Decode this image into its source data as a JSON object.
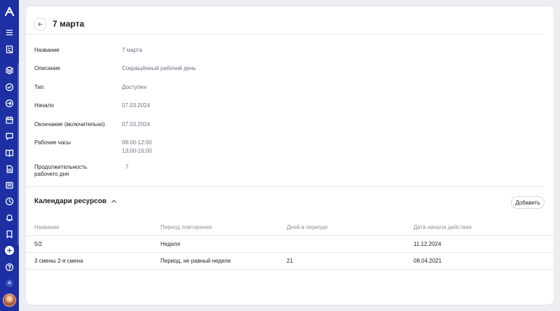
{
  "rail": {
    "items": [
      {
        "icon": "logo-icon"
      },
      {
        "icon": "menu-icon"
      },
      {
        "icon": "report-icon"
      },
      {
        "icon": "layers-icon"
      },
      {
        "icon": "check-circle-icon"
      },
      {
        "icon": "arrow-circle-icon"
      },
      {
        "icon": "calendar-icon"
      },
      {
        "icon": "chat-icon"
      },
      {
        "icon": "book-icon"
      },
      {
        "icon": "document-icon"
      },
      {
        "icon": "news-icon"
      },
      {
        "icon": "clock-icon"
      },
      {
        "icon": "bell-icon"
      },
      {
        "icon": "bookmark-icon"
      },
      {
        "icon": "plus-icon"
      },
      {
        "icon": "help-icon"
      }
    ],
    "badge": "A"
  },
  "header": {
    "title": "7 марта"
  },
  "properties": [
    {
      "label": "Название",
      "value": "7 марта"
    },
    {
      "label": "Описание",
      "value": "Сокращённый рабочий день"
    },
    {
      "label": "Тип",
      "value": "Доступен"
    },
    {
      "label": "Начало",
      "value": "07.03.2024"
    },
    {
      "label": "Окончание (включительно)",
      "value": "07.03.2024"
    },
    {
      "label": "Рабочие часы",
      "value": "08:00-12:00",
      "value2": "13:00-16:00"
    },
    {
      "label": "Продолжительность",
      "label2": "рабочего дня",
      "value": "7"
    }
  ],
  "resources": {
    "title": "Календари ресурсов",
    "add_label": "Добавить",
    "columns": [
      "Название",
      "Период повторения",
      "Дней в периоде",
      "Дата начала действия"
    ],
    "rows": [
      [
        "5/2",
        "Неделя",
        "",
        "11.12.2024"
      ],
      [
        "3 смены 2-я смена",
        "Период, не равный неделе",
        "21",
        "08.04.2021"
      ]
    ]
  },
  "colors": {
    "rail": "#1d2fa3",
    "accent": "#ffffff",
    "text": "#1c1f26",
    "muted": "#6b7280"
  }
}
